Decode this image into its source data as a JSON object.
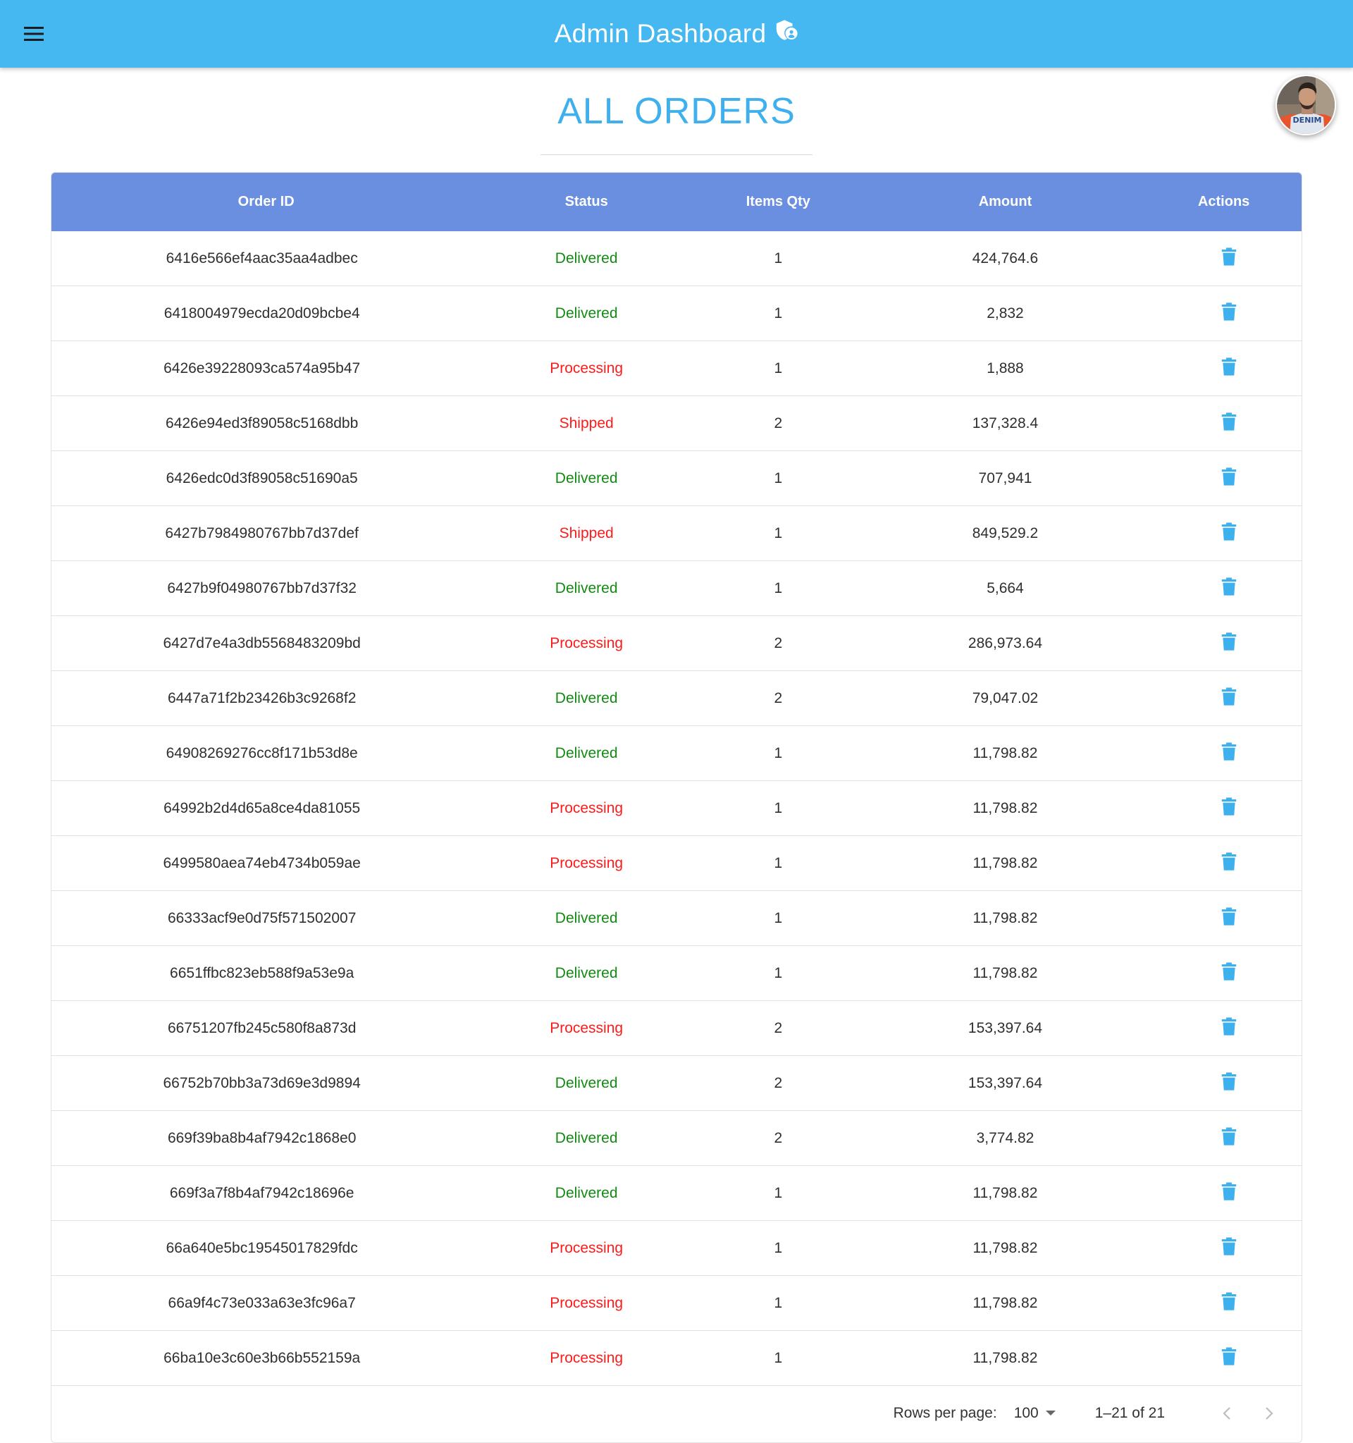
{
  "appbar": {
    "title": "Admin Dashboard",
    "menu_icon": "hamburger-menu-icon",
    "title_icon": "admin-shield-icon",
    "color": "#46b8f1"
  },
  "page": {
    "title": "ALL ORDERS",
    "title_color": "#3fb0ee"
  },
  "avatar": {
    "alt": "user profile photo"
  },
  "table": {
    "header_color": "#6a8ee0",
    "columns": [
      "Order ID",
      "Status",
      "Items Qty",
      "Amount",
      "Actions"
    ],
    "status_colors": {
      "Delivered": "#118a11",
      "Processing": "#ff1a1a",
      "Shipped": "#ff1a1a"
    },
    "action_icon": "delete-trash-icon",
    "action_color": "#3fb0ee",
    "rows": [
      {
        "id": "6416e566ef4aac35aa4adbec",
        "status": "Delivered",
        "qty": "1",
        "amount": "424,764.6"
      },
      {
        "id": "6418004979ecda20d09bcbe4",
        "status": "Delivered",
        "qty": "1",
        "amount": "2,832"
      },
      {
        "id": "6426e39228093ca574a95b47",
        "status": "Processing",
        "qty": "1",
        "amount": "1,888"
      },
      {
        "id": "6426e94ed3f89058c5168dbb",
        "status": "Shipped",
        "qty": "2",
        "amount": "137,328.4"
      },
      {
        "id": "6426edc0d3f89058c51690a5",
        "status": "Delivered",
        "qty": "1",
        "amount": "707,941"
      },
      {
        "id": "6427b7984980767bb7d37def",
        "status": "Shipped",
        "qty": "1",
        "amount": "849,529.2"
      },
      {
        "id": "6427b9f04980767bb7d37f32",
        "status": "Delivered",
        "qty": "1",
        "amount": "5,664"
      },
      {
        "id": "6427d7e4a3db5568483209bd",
        "status": "Processing",
        "qty": "2",
        "amount": "286,973.64"
      },
      {
        "id": "6447a71f2b23426b3c9268f2",
        "status": "Delivered",
        "qty": "2",
        "amount": "79,047.02"
      },
      {
        "id": "64908269276cc8f171b53d8e",
        "status": "Delivered",
        "qty": "1",
        "amount": "11,798.82"
      },
      {
        "id": "64992b2d4d65a8ce4da81055",
        "status": "Processing",
        "qty": "1",
        "amount": "11,798.82"
      },
      {
        "id": "6499580aea74eb4734b059ae",
        "status": "Processing",
        "qty": "1",
        "amount": "11,798.82"
      },
      {
        "id": "66333acf9e0d75f571502007",
        "status": "Delivered",
        "qty": "1",
        "amount": "11,798.82"
      },
      {
        "id": "6651ffbc823eb588f9a53e9a",
        "status": "Delivered",
        "qty": "1",
        "amount": "11,798.82"
      },
      {
        "id": "66751207fb245c580f8a873d",
        "status": "Processing",
        "qty": "2",
        "amount": "153,397.64"
      },
      {
        "id": "66752b70bb3a73d69e3d9894",
        "status": "Delivered",
        "qty": "2",
        "amount": "153,397.64"
      },
      {
        "id": "669f39ba8b4af7942c1868e0",
        "status": "Delivered",
        "qty": "2",
        "amount": "3,774.82"
      },
      {
        "id": "669f3a7f8b4af7942c18696e",
        "status": "Delivered",
        "qty": "1",
        "amount": "11,798.82"
      },
      {
        "id": "66a640e5bc19545017829fdc",
        "status": "Processing",
        "qty": "1",
        "amount": "11,798.82"
      },
      {
        "id": "66a9f4c73e033a63e3fc96a7",
        "status": "Processing",
        "qty": "1",
        "amount": "11,798.82"
      },
      {
        "id": "66ba10e3c60e3b66b552159a",
        "status": "Processing",
        "qty": "1",
        "amount": "11,798.82"
      }
    ]
  },
  "pagination": {
    "rows_per_page_label": "Rows per page:",
    "rows_per_page_value": "100",
    "range_text": "1–21 of 21",
    "prev_icon": "chevron-left-icon",
    "next_icon": "chevron-right-icon"
  }
}
